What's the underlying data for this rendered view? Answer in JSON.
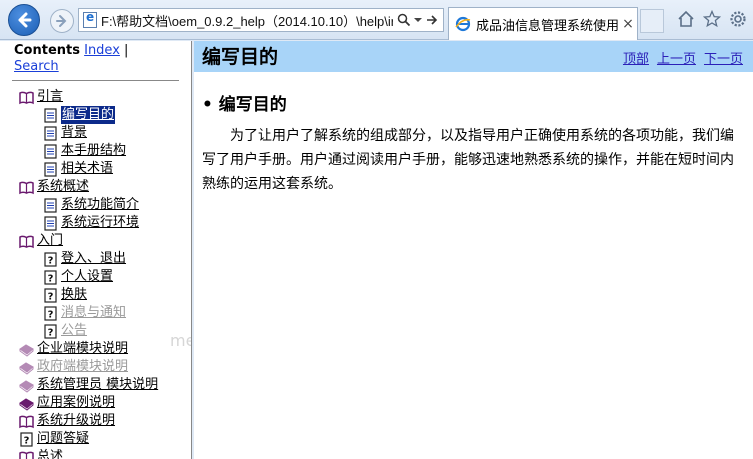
{
  "browser": {
    "address": "F:\\帮助文档\\oem_0.9.2_help（2014.10.10）\\help\\ir",
    "tab_title": "成品油信息管理系统使用...",
    "tab_close": "×"
  },
  "nav": {
    "contents_label": "Contents",
    "index_label": "Index",
    "search_label": "Search",
    "separator": "|",
    "watermark": "me",
    "tree": [
      {
        "label": "引言",
        "level": 0,
        "icon": "book-open-icon"
      },
      {
        "label": "编写目的",
        "level": 1,
        "icon": "page-icon",
        "selected": true
      },
      {
        "label": "背景",
        "level": 1,
        "icon": "page-icon"
      },
      {
        "label": "本手册结构",
        "level": 1,
        "icon": "page-icon"
      },
      {
        "label": "相关术语",
        "level": 1,
        "icon": "page-icon"
      },
      {
        "label": "系统概述",
        "level": 0,
        "icon": "book-open-icon"
      },
      {
        "label": "系统功能简介",
        "level": 1,
        "icon": "page-icon"
      },
      {
        "label": "系统运行环境",
        "level": 1,
        "icon": "page-icon"
      },
      {
        "label": "入门",
        "level": 0,
        "icon": "book-open-icon"
      },
      {
        "label": "登入、退出",
        "level": 1,
        "icon": "help-page-icon"
      },
      {
        "label": "个人设置",
        "level": 1,
        "icon": "help-page-icon"
      },
      {
        "label": "换肤",
        "level": 1,
        "icon": "help-page-icon"
      },
      {
        "label": "消息与通知",
        "level": 1,
        "icon": "help-page-icon",
        "dim": true
      },
      {
        "label": "公告",
        "level": 1,
        "icon": "help-page-icon",
        "dim": true
      },
      {
        "label": "企业端模块说明",
        "level": 0,
        "icon": "book-closed-icon",
        "dim_icon": true
      },
      {
        "label": "政府端模块说明",
        "level": 0,
        "icon": "book-closed-icon",
        "dim": true,
        "dim_icon": true
      },
      {
        "label": "系统管理员 模块说明",
        "level": 0,
        "icon": "book-closed-icon",
        "dim_icon": true
      },
      {
        "label": "应用案例说明",
        "level": 0,
        "icon": "book-closed-icon"
      },
      {
        "label": "系统升级说明",
        "level": 0,
        "icon": "book-open-icon"
      },
      {
        "label": "问题答疑",
        "level": 0,
        "icon": "help-page-icon"
      },
      {
        "label": "总述",
        "level": 0,
        "icon": "book-open-icon"
      }
    ]
  },
  "content": {
    "header_title": "编写目的",
    "links": {
      "top": "顶部",
      "prev": "上一页",
      "next": "下一页"
    },
    "section_bullet": "•",
    "section_title": "编写目的",
    "paragraph": "为了让用户了解系统的组成部分，以及指导用户正确使用系统的各项功能，我们编写了用户手册。用户通过阅读用户手册，能够迅速地熟悉系统的操作，并能在短时间内熟练的运用这套系统。"
  },
  "colors": {
    "header_bg": "#a8d4f8",
    "selected_bg": "#0c2a8a",
    "link": "#1a3fd8"
  }
}
